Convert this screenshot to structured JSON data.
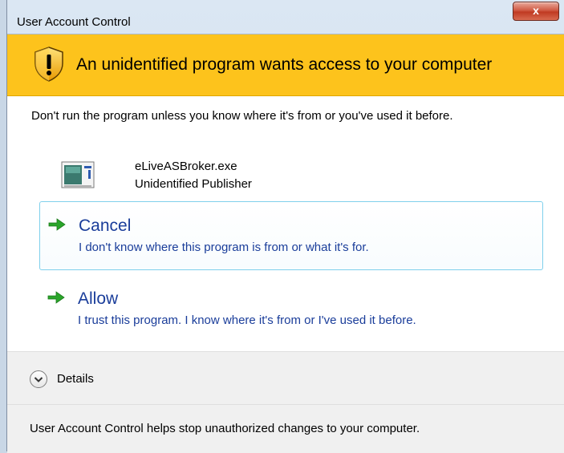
{
  "window": {
    "title": "User Account Control",
    "close_label": "x"
  },
  "header": {
    "icon": "shield-warning-icon",
    "title": "An unidentified program wants access to your computer",
    "background": "#fdc31c"
  },
  "message": "Don't run the program unless you know where it's from or you've used it before.",
  "program": {
    "name": "eLiveASBroker.exe",
    "publisher": "Unidentified Publisher",
    "icon": "application-icon"
  },
  "options": [
    {
      "title": "Cancel",
      "description": "I don't know where this program is from or what it's for.",
      "icon": "green-arrow-icon"
    },
    {
      "title": "Allow",
      "description": "I trust this program. I know where it's from or I've used it before.",
      "icon": "green-arrow-icon"
    }
  ],
  "details": {
    "label": "Details",
    "icon": "chevron-down-icon"
  },
  "footer": {
    "text": "User Account Control helps stop unauthorized changes to your computer."
  },
  "colors": {
    "accent_link": "#1a3d9a",
    "arrow_green": "#2aa52a",
    "cancel_border": "#7fd0ec"
  }
}
